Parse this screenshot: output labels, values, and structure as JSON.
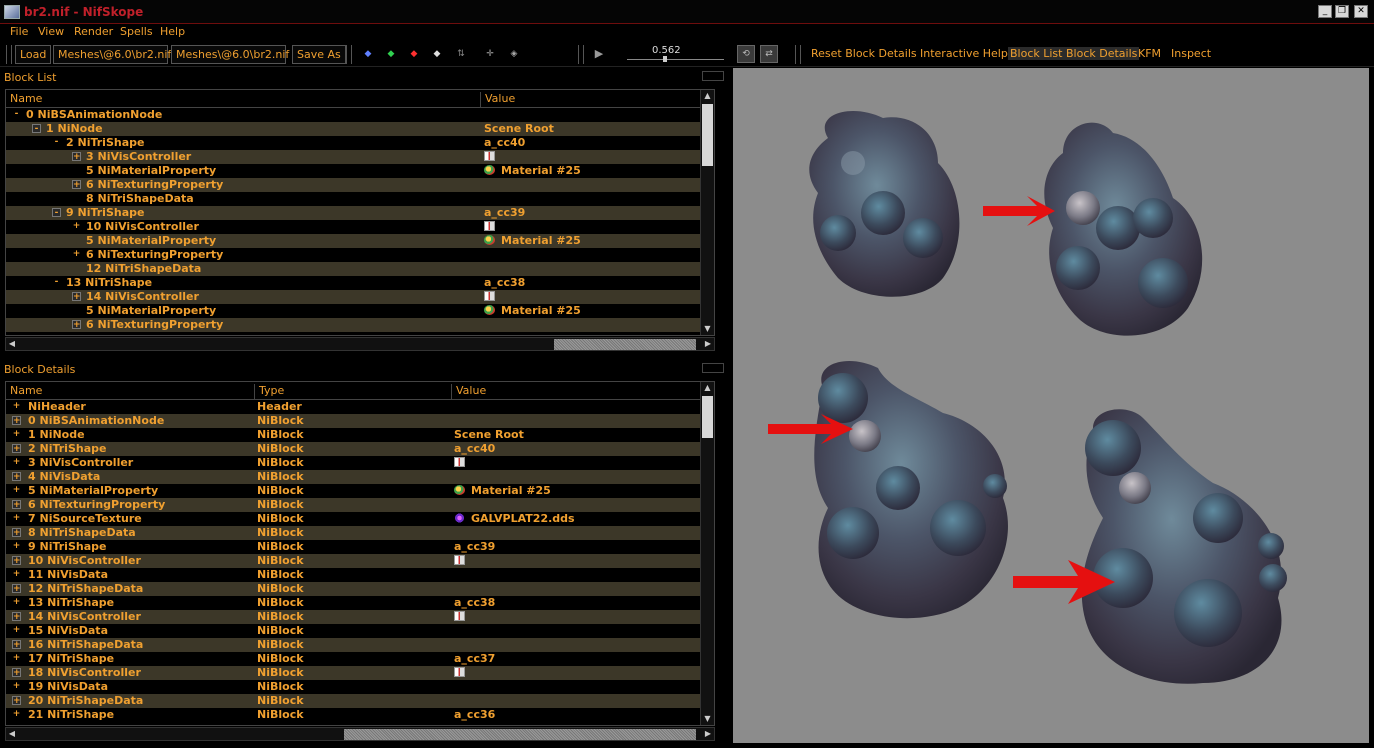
{
  "window": {
    "title": "br2.nif - NifSkope"
  },
  "menu": [
    "File",
    "View",
    "Render",
    "Spells",
    "Help"
  ],
  "toolbar": {
    "load": "Load",
    "path_in": "Meshes\\@6.0\\br2.nif",
    "path_out": "Meshes\\@6.0\\br2.nif",
    "save_as": "Save As",
    "time_value": "0.562",
    "reset_block_details": "Reset Block Details",
    "interactive_help": "Interactive Help",
    "block_list": "Block List",
    "block_details": "Block Details",
    "kfm": "KFM",
    "inspect": "Inspect"
  },
  "block_list": {
    "title": "Block List",
    "columns": [
      "Name",
      "Value"
    ],
    "rows": [
      {
        "exp": "-",
        "box": false,
        "name": "0 NiBSAnimationNode",
        "value": "",
        "icon": ""
      },
      {
        "exp": "-",
        "box": true,
        "name": "1 NiNode",
        "value": "Scene Root",
        "icon": ""
      },
      {
        "exp": "-",
        "box": false,
        "name": "2 NiTriShape",
        "value": "a_cc40",
        "icon": ""
      },
      {
        "exp": "+",
        "box": true,
        "name": "3 NiVisController",
        "value": "",
        "icon": "flag"
      },
      {
        "exp": "",
        "box": false,
        "name": "5 NiMaterialProperty",
        "value": "Material #25",
        "icon": "material"
      },
      {
        "exp": "+",
        "box": true,
        "name": "6 NiTexturingProperty",
        "value": "",
        "icon": ""
      },
      {
        "exp": "",
        "box": false,
        "name": "8 NiTriShapeData",
        "value": "",
        "icon": ""
      },
      {
        "exp": "-",
        "box": true,
        "name": "9 NiTriShape",
        "value": "a_cc39",
        "icon": ""
      },
      {
        "exp": "+",
        "box": false,
        "name": "10 NiVisController",
        "value": "",
        "icon": "flag"
      },
      {
        "exp": "",
        "box": false,
        "name": "5 NiMaterialProperty",
        "value": "Material #25",
        "icon": "material"
      },
      {
        "exp": "+",
        "box": false,
        "name": "6 NiTexturingProperty",
        "value": "",
        "icon": ""
      },
      {
        "exp": "",
        "box": false,
        "name": "12 NiTriShapeData",
        "value": "",
        "icon": ""
      },
      {
        "exp": "-",
        "box": false,
        "name": "13 NiTriShape",
        "value": "a_cc38",
        "icon": ""
      },
      {
        "exp": "+",
        "box": true,
        "name": "14 NiVisController",
        "value": "",
        "icon": "flag"
      },
      {
        "exp": "",
        "box": false,
        "name": "5 NiMaterialProperty",
        "value": "Material #25",
        "icon": "material"
      },
      {
        "exp": "+",
        "box": true,
        "name": "6 NiTexturingProperty",
        "value": "",
        "icon": ""
      }
    ]
  },
  "block_details": {
    "title": "Block Details",
    "columns": [
      "Name",
      "Type",
      "Value"
    ],
    "rows": [
      {
        "exp": "+",
        "box": false,
        "name": "NiHeader",
        "type": "Header",
        "value": "",
        "icon": ""
      },
      {
        "exp": "+",
        "box": true,
        "name": "0 NiBSAnimationNode",
        "type": "NiBlock",
        "value": "",
        "icon": ""
      },
      {
        "exp": "+",
        "box": false,
        "name": "1 NiNode",
        "type": "NiBlock",
        "value": "Scene Root",
        "icon": ""
      },
      {
        "exp": "+",
        "box": true,
        "name": "2 NiTriShape",
        "type": "NiBlock",
        "value": "a_cc40",
        "icon": ""
      },
      {
        "exp": "+",
        "box": false,
        "name": "3 NiVisController",
        "type": "NiBlock",
        "value": "",
        "icon": "flag"
      },
      {
        "exp": "+",
        "box": true,
        "name": "4 NiVisData",
        "type": "NiBlock",
        "value": "",
        "icon": ""
      },
      {
        "exp": "+",
        "box": false,
        "name": "5 NiMaterialProperty",
        "type": "NiBlock",
        "value": "Material #25",
        "icon": "material"
      },
      {
        "exp": "+",
        "box": true,
        "name": "6 NiTexturingProperty",
        "type": "NiBlock",
        "value": "",
        "icon": ""
      },
      {
        "exp": "+",
        "box": false,
        "name": "7 NiSourceTexture",
        "type": "NiBlock",
        "value": "GALVPLAT22.dds",
        "icon": "texture"
      },
      {
        "exp": "+",
        "box": true,
        "name": "8 NiTriShapeData",
        "type": "NiBlock",
        "value": "",
        "icon": ""
      },
      {
        "exp": "+",
        "box": false,
        "name": "9 NiTriShape",
        "type": "NiBlock",
        "value": "a_cc39",
        "icon": ""
      },
      {
        "exp": "+",
        "box": true,
        "name": "10 NiVisController",
        "type": "NiBlock",
        "value": "",
        "icon": "flag"
      },
      {
        "exp": "+",
        "box": false,
        "name": "11 NiVisData",
        "type": "NiBlock",
        "value": "",
        "icon": ""
      },
      {
        "exp": "+",
        "box": true,
        "name": "12 NiTriShapeData",
        "type": "NiBlock",
        "value": "",
        "icon": ""
      },
      {
        "exp": "+",
        "box": false,
        "name": "13 NiTriShape",
        "type": "NiBlock",
        "value": "a_cc38",
        "icon": ""
      },
      {
        "exp": "+",
        "box": true,
        "name": "14 NiVisController",
        "type": "NiBlock",
        "value": "",
        "icon": "flag"
      },
      {
        "exp": "+",
        "box": false,
        "name": "15 NiVisData",
        "type": "NiBlock",
        "value": "",
        "icon": ""
      },
      {
        "exp": "+",
        "box": true,
        "name": "16 NiTriShapeData",
        "type": "NiBlock",
        "value": "",
        "icon": ""
      },
      {
        "exp": "+",
        "box": false,
        "name": "17 NiTriShape",
        "type": "NiBlock",
        "value": "a_cc37",
        "icon": ""
      },
      {
        "exp": "+",
        "box": true,
        "name": "18 NiVisController",
        "type": "NiBlock",
        "value": "",
        "icon": "flag"
      },
      {
        "exp": "+",
        "box": false,
        "name": "19 NiVisData",
        "type": "NiBlock",
        "value": "",
        "icon": ""
      },
      {
        "exp": "+",
        "box": true,
        "name": "20 NiTriShapeData",
        "type": "NiBlock",
        "value": "",
        "icon": ""
      },
      {
        "exp": "+",
        "box": false,
        "name": "21 NiTriShape",
        "type": "NiBlock",
        "value": "a_cc36",
        "icon": ""
      }
    ]
  },
  "colors": {
    "accent": "#f0a030",
    "title": "#c0202a",
    "row_alt": "#3c3728",
    "viewport": "#8c8c8c",
    "arrow": "#e51010"
  }
}
